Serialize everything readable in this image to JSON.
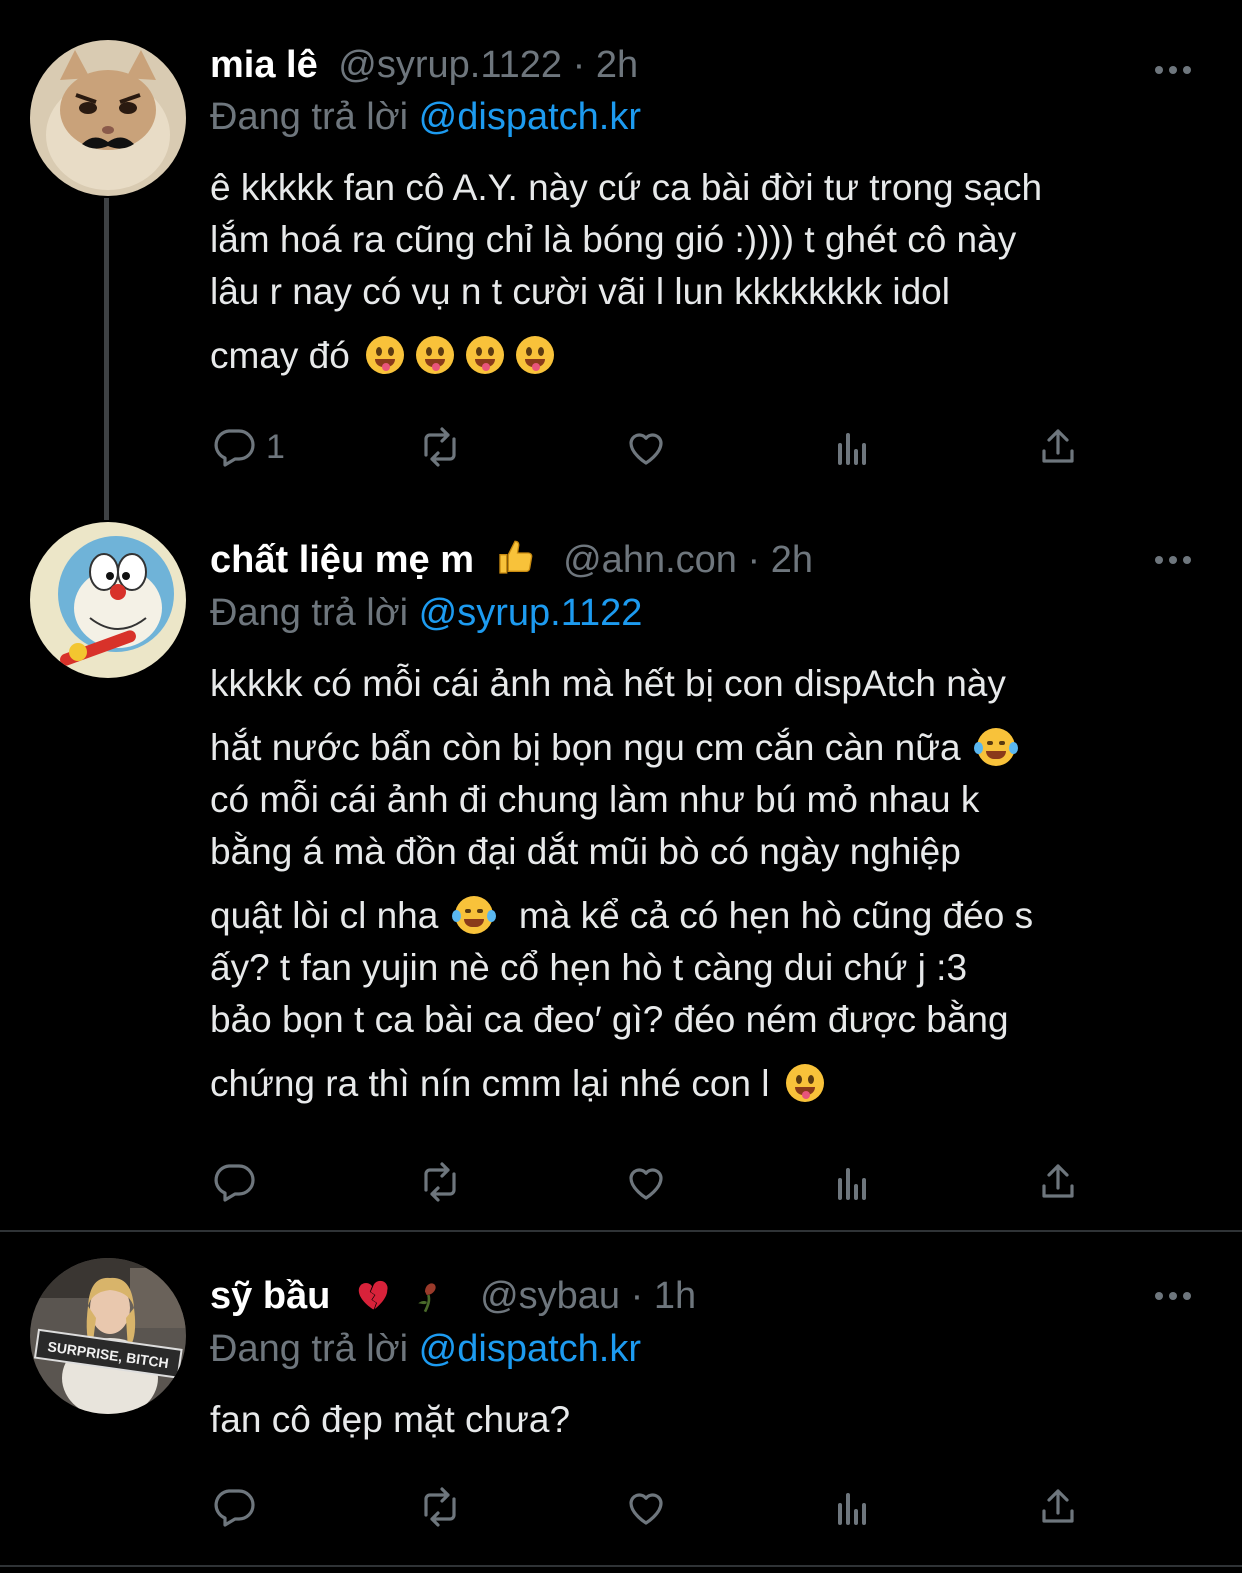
{
  "tweets": [
    {
      "name": "mia lê",
      "handle": "@syrup.1122",
      "time": "2h",
      "replying_prefix": "Đang trả lời",
      "replying_to": "@dispatch.kr",
      "lines": [
        "ê kkkkk fan cô A.Y. này cứ ca bài đời tư trong sạch",
        "lắm hoá ra cũng chỉ là bóng gió :)))) t ghét cô này",
        "lâu r nay có vụ n t cười vãi l lun kkkkkkkk idol",
        "cmay đó"
      ],
      "reply_count": "1"
    },
    {
      "name": "chất liệu mẹ m",
      "handle": "@ahn.con",
      "time": "2h",
      "replying_prefix": "Đang trả lời",
      "replying_to": "@syrup.1122",
      "lines": [
        "kkkkk có mỗi cái ảnh mà hết bị con dispAtch này",
        "hắt nước bẩn còn bị bọn ngu cm cắn càn nữa",
        "có mỗi cái ảnh đi chung làm như bú mỏ nhau k",
        "bằng á mà đồn đại dắt mũi bò có ngày nghiệp",
        "quật lòi cl nha",
        "mà kể cả có hẹn hò cũng đéo s",
        "ấy? t fan yujin nè cổ hẹn hò t càng dui chứ j :3",
        "bảo bọn t ca bài ca đeo′ gì? đéo ném được bằng",
        "chứng ra thì nín cmm lại nhé con l"
      ]
    },
    {
      "name": "sỹ bầu",
      "handle": "@sybau",
      "time": "1h",
      "replying_prefix": "Đang trả lời",
      "replying_to": "@dispatch.kr",
      "lines": [
        "fan cô đẹp mặt chưa?"
      ]
    }
  ],
  "avatar_sign_text": "SURPRISE, BITCH",
  "colors": {
    "background": "#000000",
    "text": "#e7e9ea",
    "secondary": "#6e767d",
    "link": "#1d9bf0",
    "divider": "#2f3336"
  },
  "icons": [
    "reply-icon",
    "retweet-icon",
    "like-icon",
    "analytics-icon",
    "share-icon",
    "more-icon"
  ]
}
